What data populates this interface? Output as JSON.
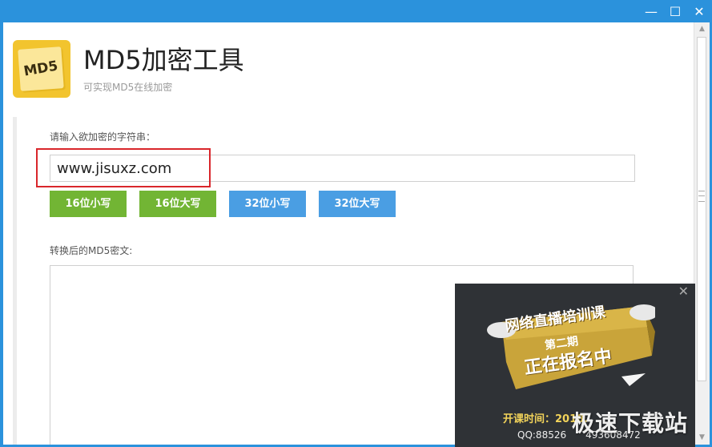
{
  "window": {
    "minimize": "—",
    "maximize": "☐",
    "close": "✕"
  },
  "header": {
    "logo_text": "MD5",
    "title": "MD5加密工具",
    "subtitle": "可实现MD5在线加密"
  },
  "form": {
    "input_label": "请输入欲加密的字符串：",
    "input_value": "www.jisuxz.com",
    "buttons": [
      {
        "label": "16位小写",
        "color": "#72b534"
      },
      {
        "label": "16位大写",
        "color": "#72b534"
      },
      {
        "label": "32位小写",
        "color": "#4a9ee3"
      },
      {
        "label": "32位大写",
        "color": "#4a9ee3"
      }
    ],
    "output_label": "转换后的MD5密文:",
    "output_value": ""
  },
  "ad": {
    "close": "✕",
    "headline": "网络直播培训课",
    "sub": "第二期",
    "status": "正在报名中",
    "time_label": "开课时间：2018.",
    "contact": "QQ:88526　　493608472"
  },
  "watermark": "极速下载站",
  "colors": {
    "titlebar": "#2b92dc",
    "green_button": "#72b534",
    "blue_button": "#4a9ee3",
    "highlight": "#d9262b"
  }
}
